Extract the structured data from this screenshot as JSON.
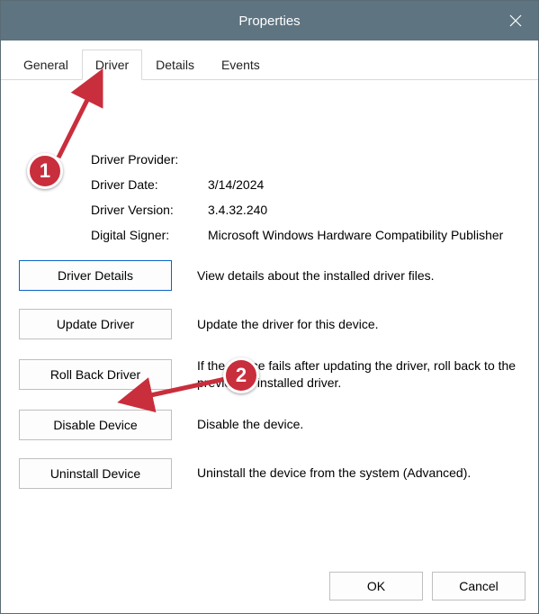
{
  "window": {
    "title": "Properties"
  },
  "tabs": {
    "general": "General",
    "driver": "Driver",
    "details": "Details",
    "events": "Events",
    "active": "driver"
  },
  "info": {
    "provider_label": "Driver Provider:",
    "provider_value": "",
    "date_label": "Driver Date:",
    "date_value": "3/14/2024",
    "version_label": "Driver Version:",
    "version_value": "3.4.32.240",
    "signer_label": "Digital Signer:",
    "signer_value": "Microsoft Windows Hardware Compatibility Publisher"
  },
  "actions": {
    "details": {
      "label": "Driver Details",
      "desc": "View details about the installed driver files."
    },
    "update": {
      "label": "Update Driver",
      "desc": "Update the driver for this device."
    },
    "rollback": {
      "label": "Roll Back Driver",
      "desc": "If the device fails after updating the driver, roll back to the previously installed driver."
    },
    "disable": {
      "label": "Disable Device",
      "desc": "Disable the device."
    },
    "uninstall": {
      "label": "Uninstall Device",
      "desc": "Uninstall the device from the system (Advanced)."
    }
  },
  "footer": {
    "ok": "OK",
    "cancel": "Cancel"
  },
  "annotations": {
    "badge1": "1",
    "badge2": "2"
  }
}
